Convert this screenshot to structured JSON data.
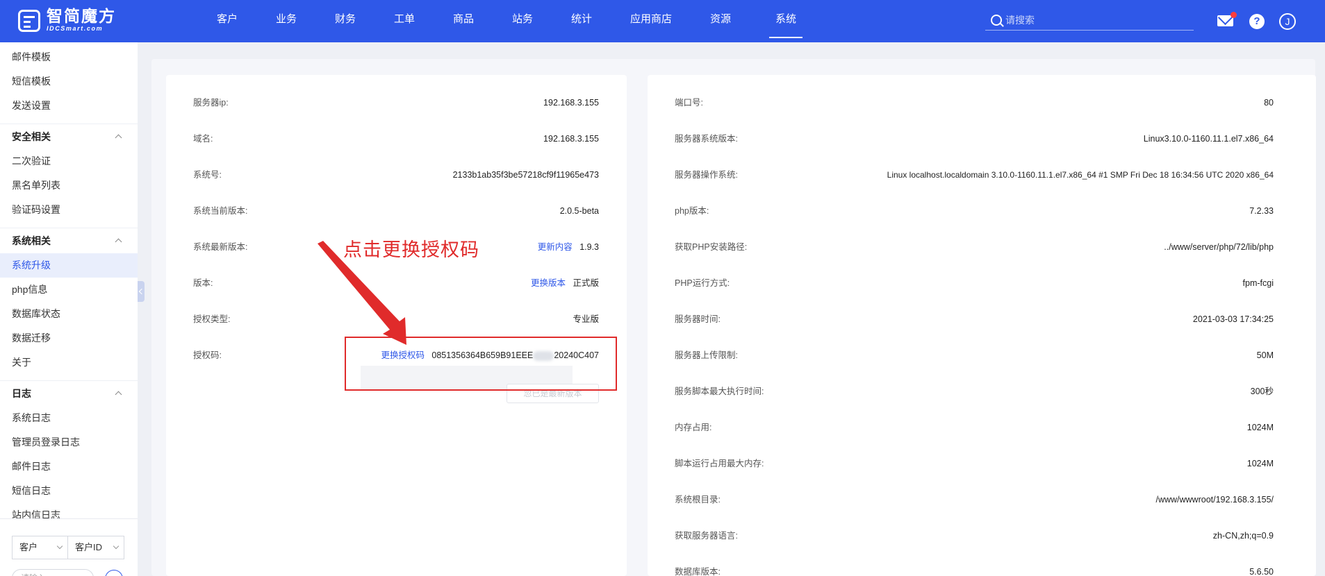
{
  "header": {
    "logo_title": "智简魔方",
    "logo_sub": "IDCSmart.com",
    "nav": [
      {
        "label": "客户",
        "active": false
      },
      {
        "label": "业务",
        "active": false
      },
      {
        "label": "财务",
        "active": false
      },
      {
        "label": "工单",
        "active": false
      },
      {
        "label": "商品",
        "active": false
      },
      {
        "label": "站务",
        "active": false
      },
      {
        "label": "统计",
        "active": false
      },
      {
        "label": "应用商店",
        "active": false
      },
      {
        "label": "资源",
        "active": false
      },
      {
        "label": "系统",
        "active": true
      }
    ],
    "search_placeholder": "请搜索",
    "help_glyph": "?",
    "user_initial": "J"
  },
  "sidebar": {
    "items_top": [
      "邮件模板",
      "短信模板",
      "发送设置"
    ],
    "group_security": "安全相关",
    "items_security": [
      "二次验证",
      "黑名单列表",
      "验证码设置"
    ],
    "group_system": "系统相关",
    "items_system": [
      "系统升级",
      "php信息",
      "数据库状态",
      "数据迁移",
      "关于"
    ],
    "active_item": "系统升级",
    "group_log": "日志",
    "items_log": [
      "系统日志",
      "管理员登录日志",
      "邮件日志",
      "短信日志",
      "站内信日志"
    ],
    "filter_select_1": "客户",
    "filter_select_2": "客户ID",
    "filter_input_placeholder": "请输入"
  },
  "left_panel": {
    "rows": [
      {
        "label": "服务器ip:",
        "value": "192.168.3.155"
      },
      {
        "label": "域名:",
        "value": "192.168.3.155"
      },
      {
        "label": "系统号:",
        "value": "2133b1ab35f3be57218cf9f11965e473"
      },
      {
        "label": "系统当前版本:",
        "value": "2.0.5-beta"
      },
      {
        "label": "系统最新版本:",
        "link": "更新内容",
        "value": "1.9.3"
      },
      {
        "label": "版本:",
        "link": "更换版本",
        "value": "正式版"
      },
      {
        "label": "授权类型:",
        "value": "专业版"
      },
      {
        "label": "授权码:",
        "link": "更换授权码",
        "value_prefix": "0851356364B659B91EEE",
        "value_suffix": "20240C407"
      }
    ],
    "ghost_button": "忽已是最新版本"
  },
  "right_panel": {
    "rows": [
      {
        "label": "端口号:",
        "value": "80"
      },
      {
        "label": "服务器系统版本:",
        "value": "Linux3.10.0-1160.11.1.el7.x86_64"
      },
      {
        "label": "服务器操作系统:",
        "value": "Linux localhost.localdomain 3.10.0-1160.11.1.el7.x86_64 #1 SMP Fri Dec 18 16:34:56 UTC 2020 x86_64"
      },
      {
        "label": "php版本:",
        "value": "7.2.33"
      },
      {
        "label": "获取PHP安装路径:",
        "value": "../www/server/php/72/lib/php"
      },
      {
        "label": "PHP运行方式:",
        "value": "fpm-fcgi"
      },
      {
        "label": "服务器时间:",
        "value": "2021-03-03 17:34:25"
      },
      {
        "label": "服务器上传限制:",
        "value": "50M"
      },
      {
        "label": "服务脚本最大执行时间:",
        "value": "300秒"
      },
      {
        "label": "内存占用:",
        "value": "1024M"
      },
      {
        "label": "脚本运行占用最大内存:",
        "value": "1024M"
      },
      {
        "label": "系统根目录:",
        "value": "/www/wwwroot/192.168.3.155/"
      },
      {
        "label": "获取服务器语言:",
        "value": "zh-CN,zh;q=0.9"
      },
      {
        "label": "数据库版本:",
        "value": "5.6.50"
      }
    ]
  },
  "annotation": {
    "text": "点击更换授权码",
    "color": "#e02b2b"
  },
  "colors": {
    "brand": "#2f58e8",
    "link": "#2f58e8",
    "annotation": "#e02b2b"
  }
}
